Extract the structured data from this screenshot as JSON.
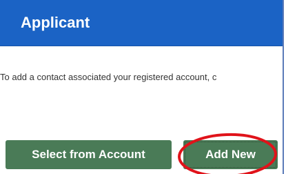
{
  "header": {
    "title": "Applicant",
    "background_color": "#1b63c5"
  },
  "instruction": {
    "text": "To add a contact associated your registered account, c"
  },
  "buttons": {
    "select_from_account": "Select from Account",
    "add_new": "Add New",
    "button_color": "#4a7b57"
  },
  "annotation": {
    "highlight_color": "#e0131a"
  }
}
